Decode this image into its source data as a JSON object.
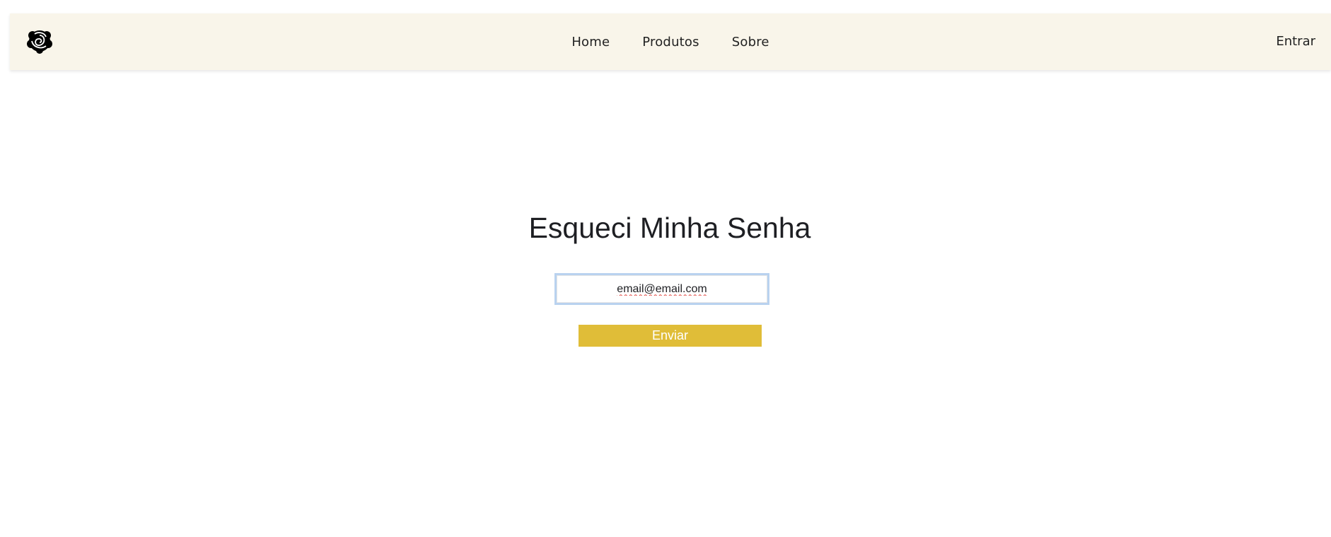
{
  "nav": {
    "logo_icon": "rose-flower-icon",
    "links": [
      {
        "label": "Home"
      },
      {
        "label": "Produtos"
      },
      {
        "label": "Sobre"
      }
    ],
    "login_label": "Entrar"
  },
  "main": {
    "title": "Esqueci Minha Senha",
    "email_value": "email@email.com",
    "submit_label": "Enviar"
  },
  "colors": {
    "navbar_bg": "#f9f5ea",
    "button_bg": "#e0bd38",
    "input_focus_border": "#b9d2ef",
    "text": "#1e1f23"
  }
}
